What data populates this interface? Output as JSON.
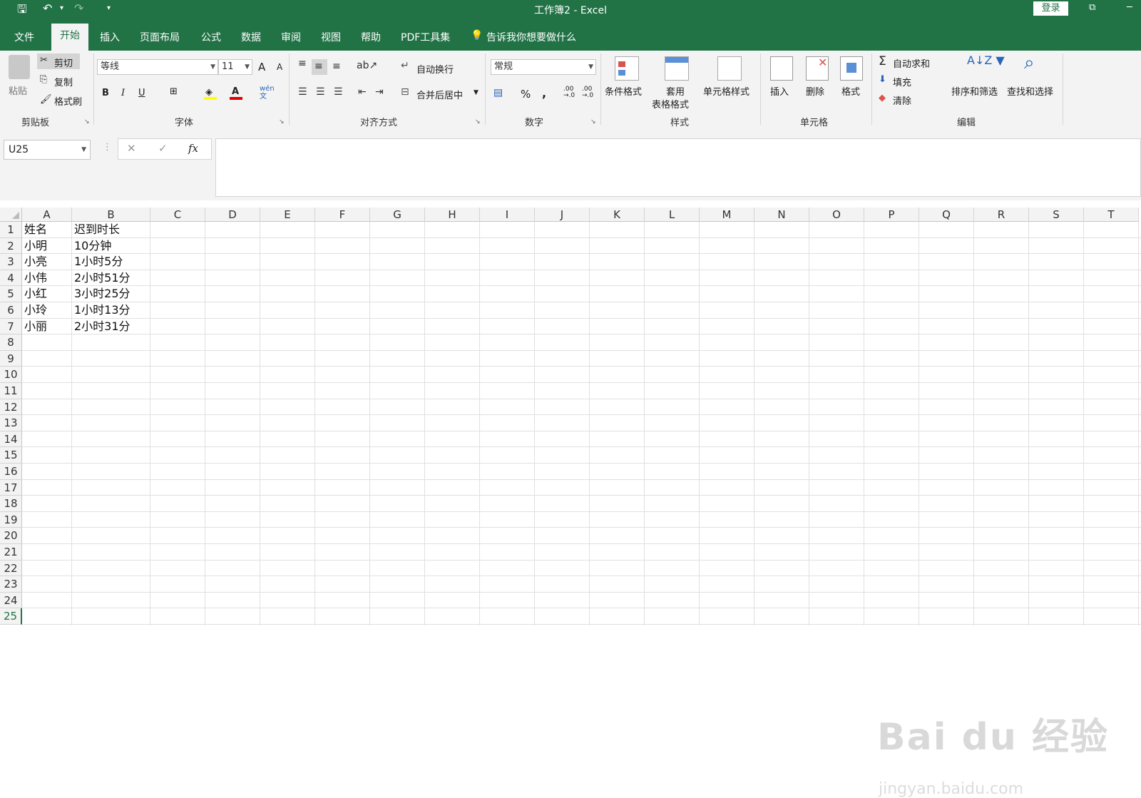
{
  "window": {
    "title": "工作簿2  -  Excel",
    "login": "登录",
    "qat": {
      "save_glyph": "🖫",
      "undo_glyph": "↶",
      "redo_glyph": "↷",
      "more_glyph": "▾"
    },
    "win_glyph_1": "⧉",
    "win_glyph_2": "─"
  },
  "tabs": [
    "文件",
    "开始",
    "插入",
    "页面布局",
    "公式",
    "数据",
    "审阅",
    "视图",
    "帮助",
    "PDF工具集"
  ],
  "active_tab": "开始",
  "tell_me": "告诉我你想要做什么",
  "ribbon": {
    "clipboard": {
      "paste": "粘贴",
      "cut": "剪切",
      "copy": "复制",
      "format_painter": "格式刷",
      "label": "剪贴板"
    },
    "font": {
      "name": "等线",
      "size": "11",
      "bold": "B",
      "italic": "I",
      "underline": "U",
      "grow": "A",
      "shrink": "A",
      "phonetic": "wén 文",
      "label": "字体"
    },
    "alignment": {
      "wrap": "自动换行",
      "merge": "合并后居中",
      "label": "对齐方式"
    },
    "number": {
      "format": "常规",
      "percent": "%",
      "comma": ",",
      "inc_dec": ".00 →.0",
      "dec_dec": ".00 →.0",
      "label": "数字"
    },
    "styles": {
      "conditional": "条件格式",
      "table_1": "套用",
      "table_2": "表格格式",
      "cell_styles": "单元格样式",
      "label": "样式"
    },
    "cells": {
      "insert": "插入",
      "delete": "删除",
      "format": "格式",
      "label": "单元格"
    },
    "editing": {
      "autosum": "自动求和",
      "fill": "填充",
      "clear": "清除",
      "sort": "排序和筛选",
      "find": "查找和选择",
      "label": "编辑"
    }
  },
  "formula_bar": {
    "name_box": "U25",
    "cancel": "✕",
    "enter": "✓",
    "fx": "fx",
    "content": ""
  },
  "columns": [
    "A",
    "B",
    "C",
    "D",
    "E",
    "F",
    "G",
    "H",
    "I",
    "J",
    "K",
    "L",
    "M",
    "N",
    "O",
    "P",
    "Q",
    "R",
    "S",
    "T"
  ],
  "rows": [
    "1",
    "2",
    "3",
    "4",
    "5",
    "6",
    "7",
    "8",
    "9",
    "10",
    "11",
    "12",
    "13",
    "14",
    "15",
    "16",
    "17",
    "18",
    "19",
    "20",
    "21",
    "22",
    "23",
    "24",
    "25"
  ],
  "cells": [
    [
      "姓名",
      "迟到时长"
    ],
    [
      "小明",
      "10分钟"
    ],
    [
      "小亮",
      "1小时5分"
    ],
    [
      "小伟",
      "2小时51分"
    ],
    [
      "小红",
      "3小时25分"
    ],
    [
      "小玲",
      "1小时13分"
    ],
    [
      "小丽",
      "2小时31分"
    ]
  ],
  "watermark": {
    "brand": "Bai du 经验",
    "url": "jingyan.baidu.com"
  }
}
